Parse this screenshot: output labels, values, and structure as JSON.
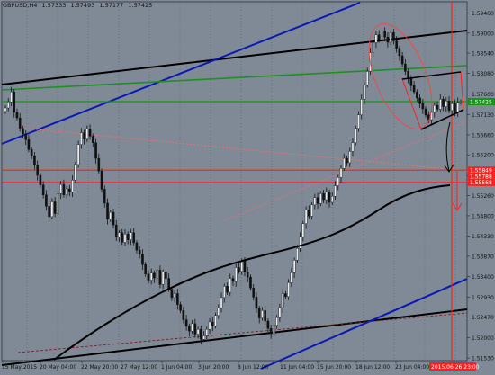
{
  "header": {
    "symbol_timeframe": "GBPUSD,H4",
    "quote_values": [
      "1.57333",
      "1.57493",
      "1.57177",
      "1.57425"
    ]
  },
  "colors": {
    "background": "#7f8a96",
    "candle_up": "#e9eef2",
    "candle_down": "#111111",
    "channel_black": "#000000",
    "channel_blue": "#0a18b5",
    "green_line": "#1f8f1f",
    "red_line": "#ff2020",
    "red_dotted": "#ff6a6a",
    "maroon_dotted": "#7a1e1e",
    "price_tag_green": "#1f8f1f",
    "price_tag_red": "#ff2020",
    "date_tag_red": "#ff2020",
    "vertical_separator": "#55606b"
  },
  "chart_data": {
    "type": "candlestick",
    "symbol": "GBPUSD",
    "timeframe": "H4",
    "ylim": [
      1.5147,
      1.5972
    ],
    "y_ticks": [
      "1.59460",
      "1.59000",
      "1.58540",
      "1.58080",
      "1.57600",
      "1.57130",
      "1.56660",
      "1.56200",
      "1.55720",
      "1.55260",
      "1.54800",
      "1.54330",
      "1.53870",
      "1.53400",
      "1.52930",
      "1.52470",
      "1.52000",
      "1.51530"
    ],
    "x_ticks": [
      "15 May 2015",
      "20 May 04:00",
      "22 May 20:00",
      "27 May 12:00",
      "1 Jun 04:00",
      "3 Jun 20:00",
      "8 Jun 12:00",
      "11 Jun 04:00",
      "15 Jun 20:00",
      "18 Jun 12:00",
      "23 Jun 04:00"
    ],
    "price_tags": [
      {
        "label": "1.57425",
        "value": 1.57425,
        "color": "green"
      },
      {
        "label": "1.55849",
        "value": 1.55849,
        "color": "red"
      },
      {
        "label": "1.55788",
        "value": 1.55788,
        "color": "red"
      },
      {
        "label": "1.55568",
        "value": 1.55568,
        "color": "red"
      }
    ],
    "date_tag": "2015.06.26 23:00",
    "horizontal_lines": [
      {
        "value": 1.57425,
        "color": "green"
      },
      {
        "value": 1.55849,
        "color": "red"
      },
      {
        "value": 1.55568,
        "color": "red"
      }
    ],
    "closes": [
      1.5728,
      1.5742,
      1.5765,
      1.5718,
      1.5705,
      1.5681,
      1.5668,
      1.5655,
      1.5632,
      1.5618,
      1.5596,
      1.5573,
      1.5551,
      1.5528,
      1.5502,
      1.5478,
      1.5512,
      1.5485,
      1.5531,
      1.5552,
      1.5528,
      1.5542,
      1.5535,
      1.5562,
      1.5598,
      1.5644,
      1.5671,
      1.5656,
      1.5679,
      1.5663,
      1.5648,
      1.5612,
      1.5583,
      1.5541,
      1.5509,
      1.5472,
      1.5488,
      1.5459,
      1.5432,
      1.5441,
      1.5419,
      1.5438,
      1.5425,
      1.5441,
      1.5418,
      1.5401,
      1.5392,
      1.5368,
      1.5346,
      1.5332,
      1.5348,
      1.5337,
      1.5355,
      1.5322,
      1.5351,
      1.5336,
      1.5311,
      1.5292,
      1.5301,
      1.5276,
      1.5262,
      1.5241,
      1.5226,
      1.5215,
      1.5232,
      1.5208,
      1.5219,
      1.5196,
      1.5204,
      1.5219,
      1.5236,
      1.5227,
      1.5251,
      1.5268,
      1.5292,
      1.5318,
      1.5304,
      1.5336,
      1.5329,
      1.5361,
      1.5352,
      1.5376,
      1.5351,
      1.5339,
      1.5314,
      1.5293,
      1.5267,
      1.5245,
      1.5262,
      1.5238,
      1.5221,
      1.5209,
      1.5228,
      1.5246,
      1.5269,
      1.5301,
      1.5294,
      1.5326,
      1.5349,
      1.5378,
      1.5405,
      1.5431,
      1.5462,
      1.5493,
      1.5479,
      1.5505,
      1.5522,
      1.5508,
      1.5531,
      1.5517,
      1.5534,
      1.5511,
      1.5525,
      1.5549,
      1.5568,
      1.5589,
      1.5612,
      1.5602,
      1.5628,
      1.5648,
      1.5681,
      1.5712,
      1.5748,
      1.5781,
      1.5812,
      1.5855,
      1.5878,
      1.5896,
      1.5884,
      1.5905,
      1.5891,
      1.5879,
      1.5901,
      1.5882,
      1.5865,
      1.5848,
      1.5829,
      1.5812,
      1.5795,
      1.5779,
      1.5765,
      1.5751,
      1.5738,
      1.5726,
      1.5712,
      1.5701,
      1.5718,
      1.5734,
      1.5725,
      1.5748,
      1.5731,
      1.5744,
      1.5722,
      1.5738,
      1.5719,
      1.5741,
      1.5742
    ]
  }
}
